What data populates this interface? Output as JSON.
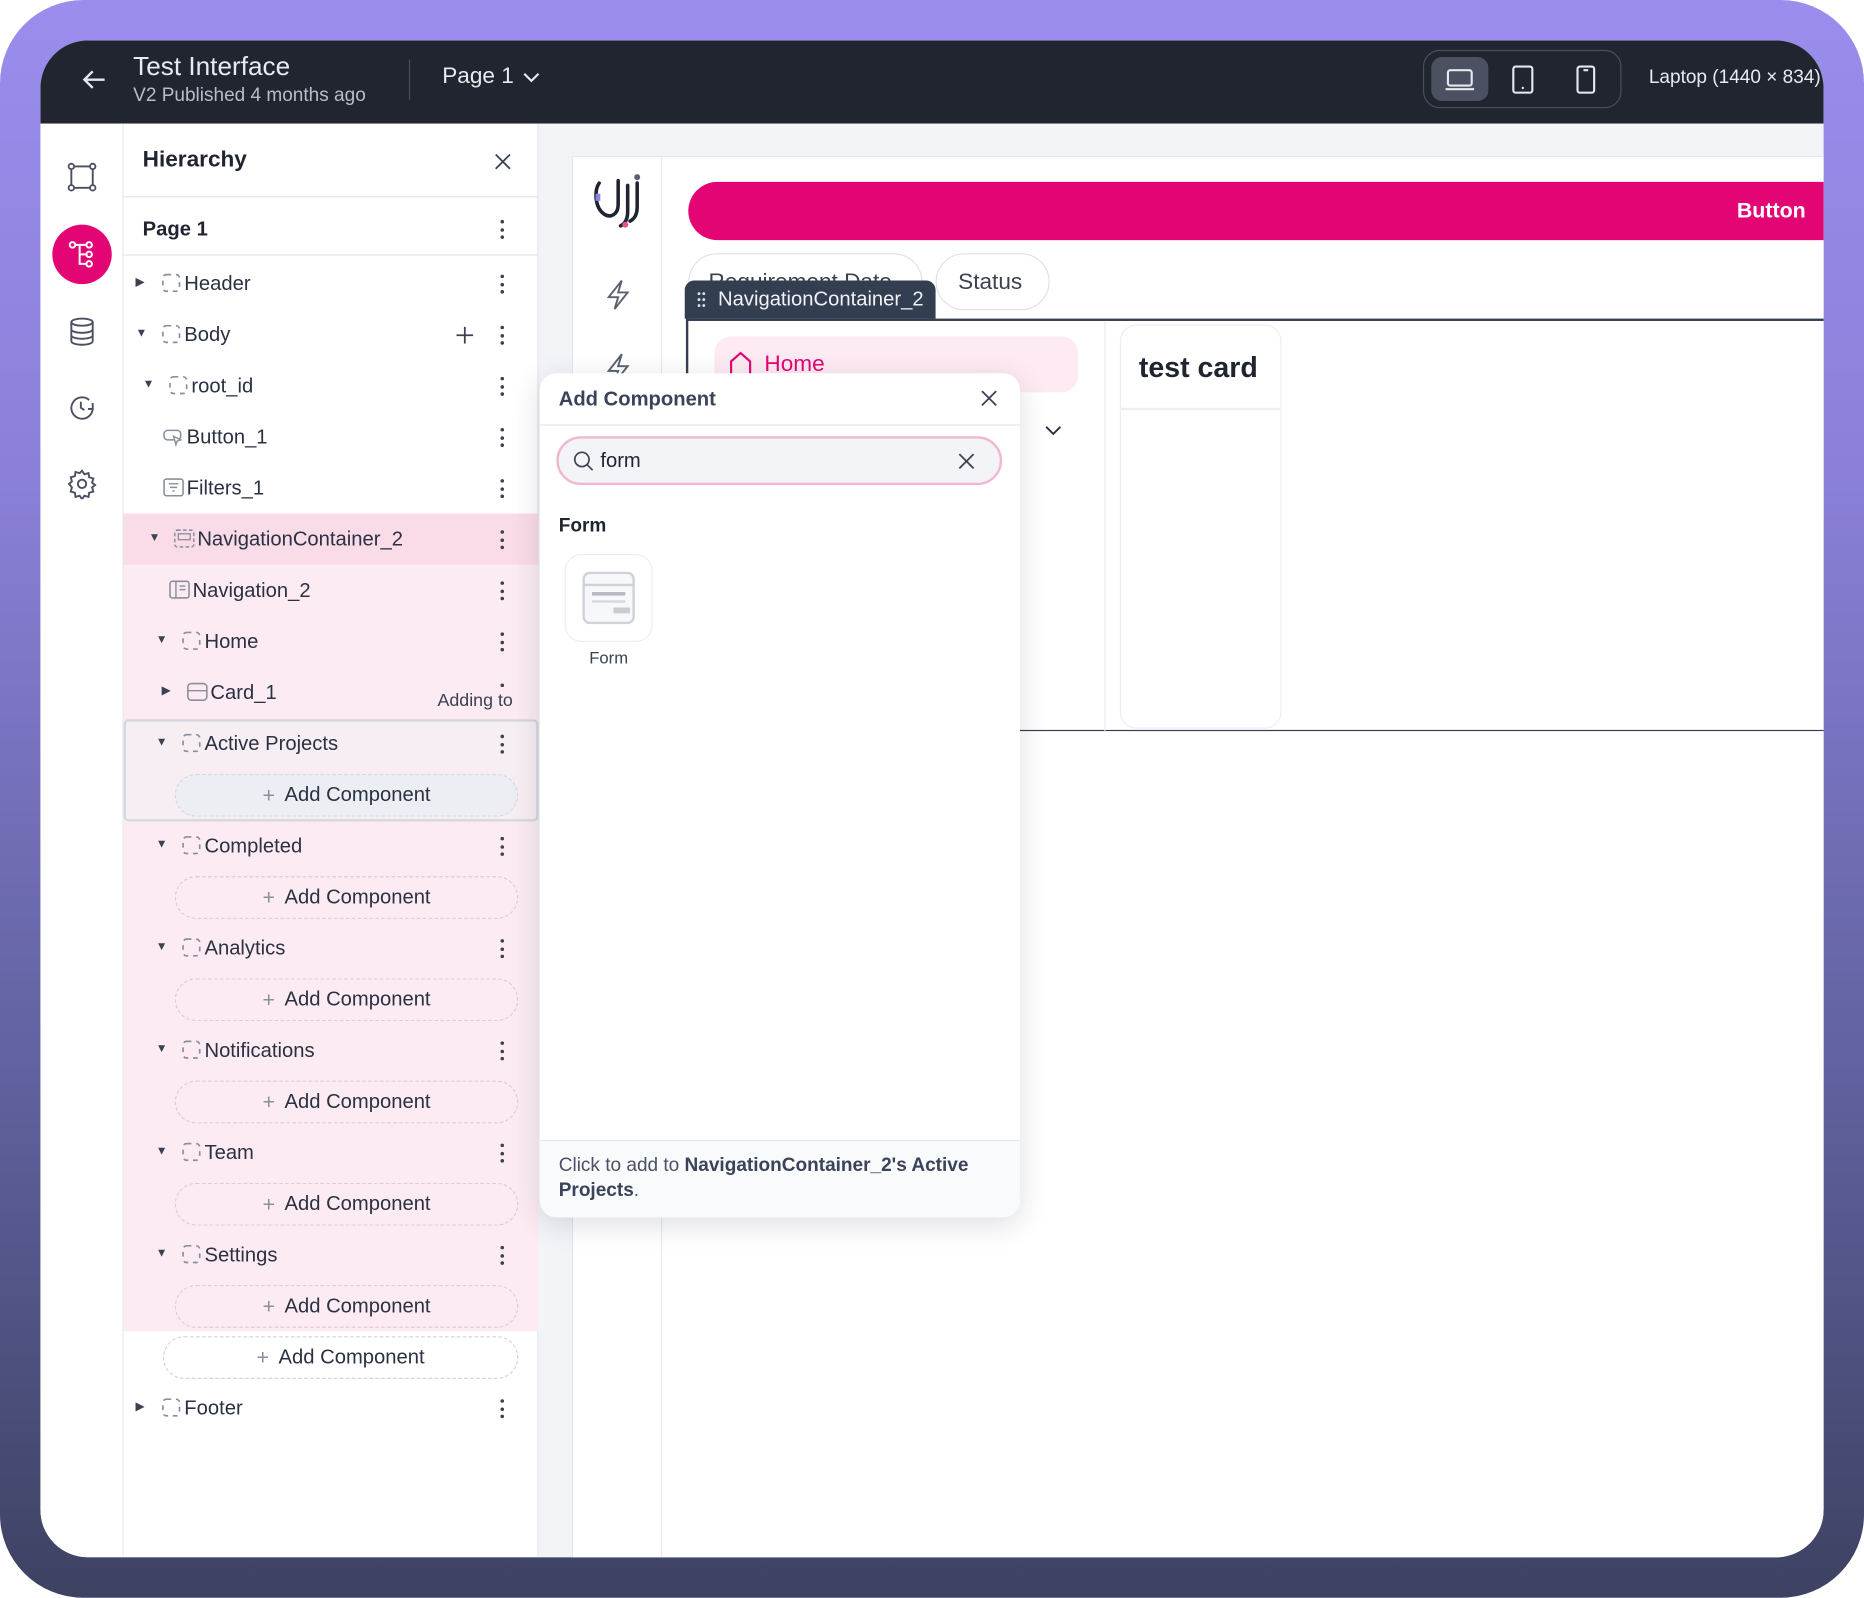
{
  "topbar": {
    "title": "Test Interface",
    "subtitle": "V2 Published 4 months ago",
    "page": "Page 1",
    "device_label": "Laptop (1440 × 834)",
    "devices": [
      "laptop-icon",
      "tablet-icon",
      "mobile-icon"
    ],
    "active_device": "laptop"
  },
  "rail": {
    "items": [
      "frame-icon",
      "hierarchy-icon",
      "database-icon",
      "history-icon",
      "settings-icon"
    ],
    "active": "hierarchy-icon",
    "accent": "#e20573"
  },
  "hierarchy": {
    "title": "Hierarchy",
    "page": "Page 1",
    "tooltip": "Adding to",
    "rows": [
      {
        "label": "Header",
        "caret": "right",
        "icon": "container"
      },
      {
        "label": "Body",
        "caret": "down",
        "icon": "container",
        "plus": true
      },
      {
        "label": "root_id",
        "caret": "down",
        "icon": "container"
      },
      {
        "label": "Button_1",
        "caret": "",
        "icon": "button"
      },
      {
        "label": "Filters_1",
        "caret": "",
        "icon": "filter"
      },
      {
        "label": "NavigationContainer_2",
        "caret": "down",
        "icon": "navcontainer",
        "selected": true
      },
      {
        "label": "Navigation_2",
        "caret": "",
        "icon": "navigation"
      },
      {
        "label": "Home",
        "caret": "down",
        "icon": "container"
      },
      {
        "label": "Card_1",
        "caret": "right",
        "icon": "card"
      },
      {
        "label": "Active Projects",
        "caret": "down",
        "icon": "container",
        "target": true
      },
      {
        "label": "Add Component",
        "add": true
      },
      {
        "label": "Completed",
        "caret": "down",
        "icon": "container"
      },
      {
        "label": "Add Component",
        "add": true
      },
      {
        "label": "Analytics",
        "caret": "down",
        "icon": "container"
      },
      {
        "label": "Add Component",
        "add": true
      },
      {
        "label": "Notifications",
        "caret": "down",
        "icon": "container"
      },
      {
        "label": "Add Component",
        "add": true
      },
      {
        "label": "Team",
        "caret": "down",
        "icon": "container"
      },
      {
        "label": "Add Component",
        "add": true
      },
      {
        "label": "Settings",
        "caret": "down",
        "icon": "container"
      },
      {
        "label": "Add Component",
        "add": true
      },
      {
        "label": "Add Component",
        "add": true
      },
      {
        "label": "Footer",
        "caret": "right",
        "icon": "container"
      }
    ]
  },
  "canvas": {
    "button_label": "Button",
    "chips": [
      "Requirement Date",
      "Status"
    ],
    "nav_container_label": "NavigationContainer_2",
    "nav_item": "Home",
    "card_title": "test card",
    "accent": "#e20573"
  },
  "popup": {
    "title": "Add Component",
    "search_value": "form",
    "section": "Form",
    "tile_label": "Form",
    "footer_prefix": "Click to add to ",
    "footer_target": "NavigationContainer_2's Active Projects",
    "footer_suffix": "."
  }
}
